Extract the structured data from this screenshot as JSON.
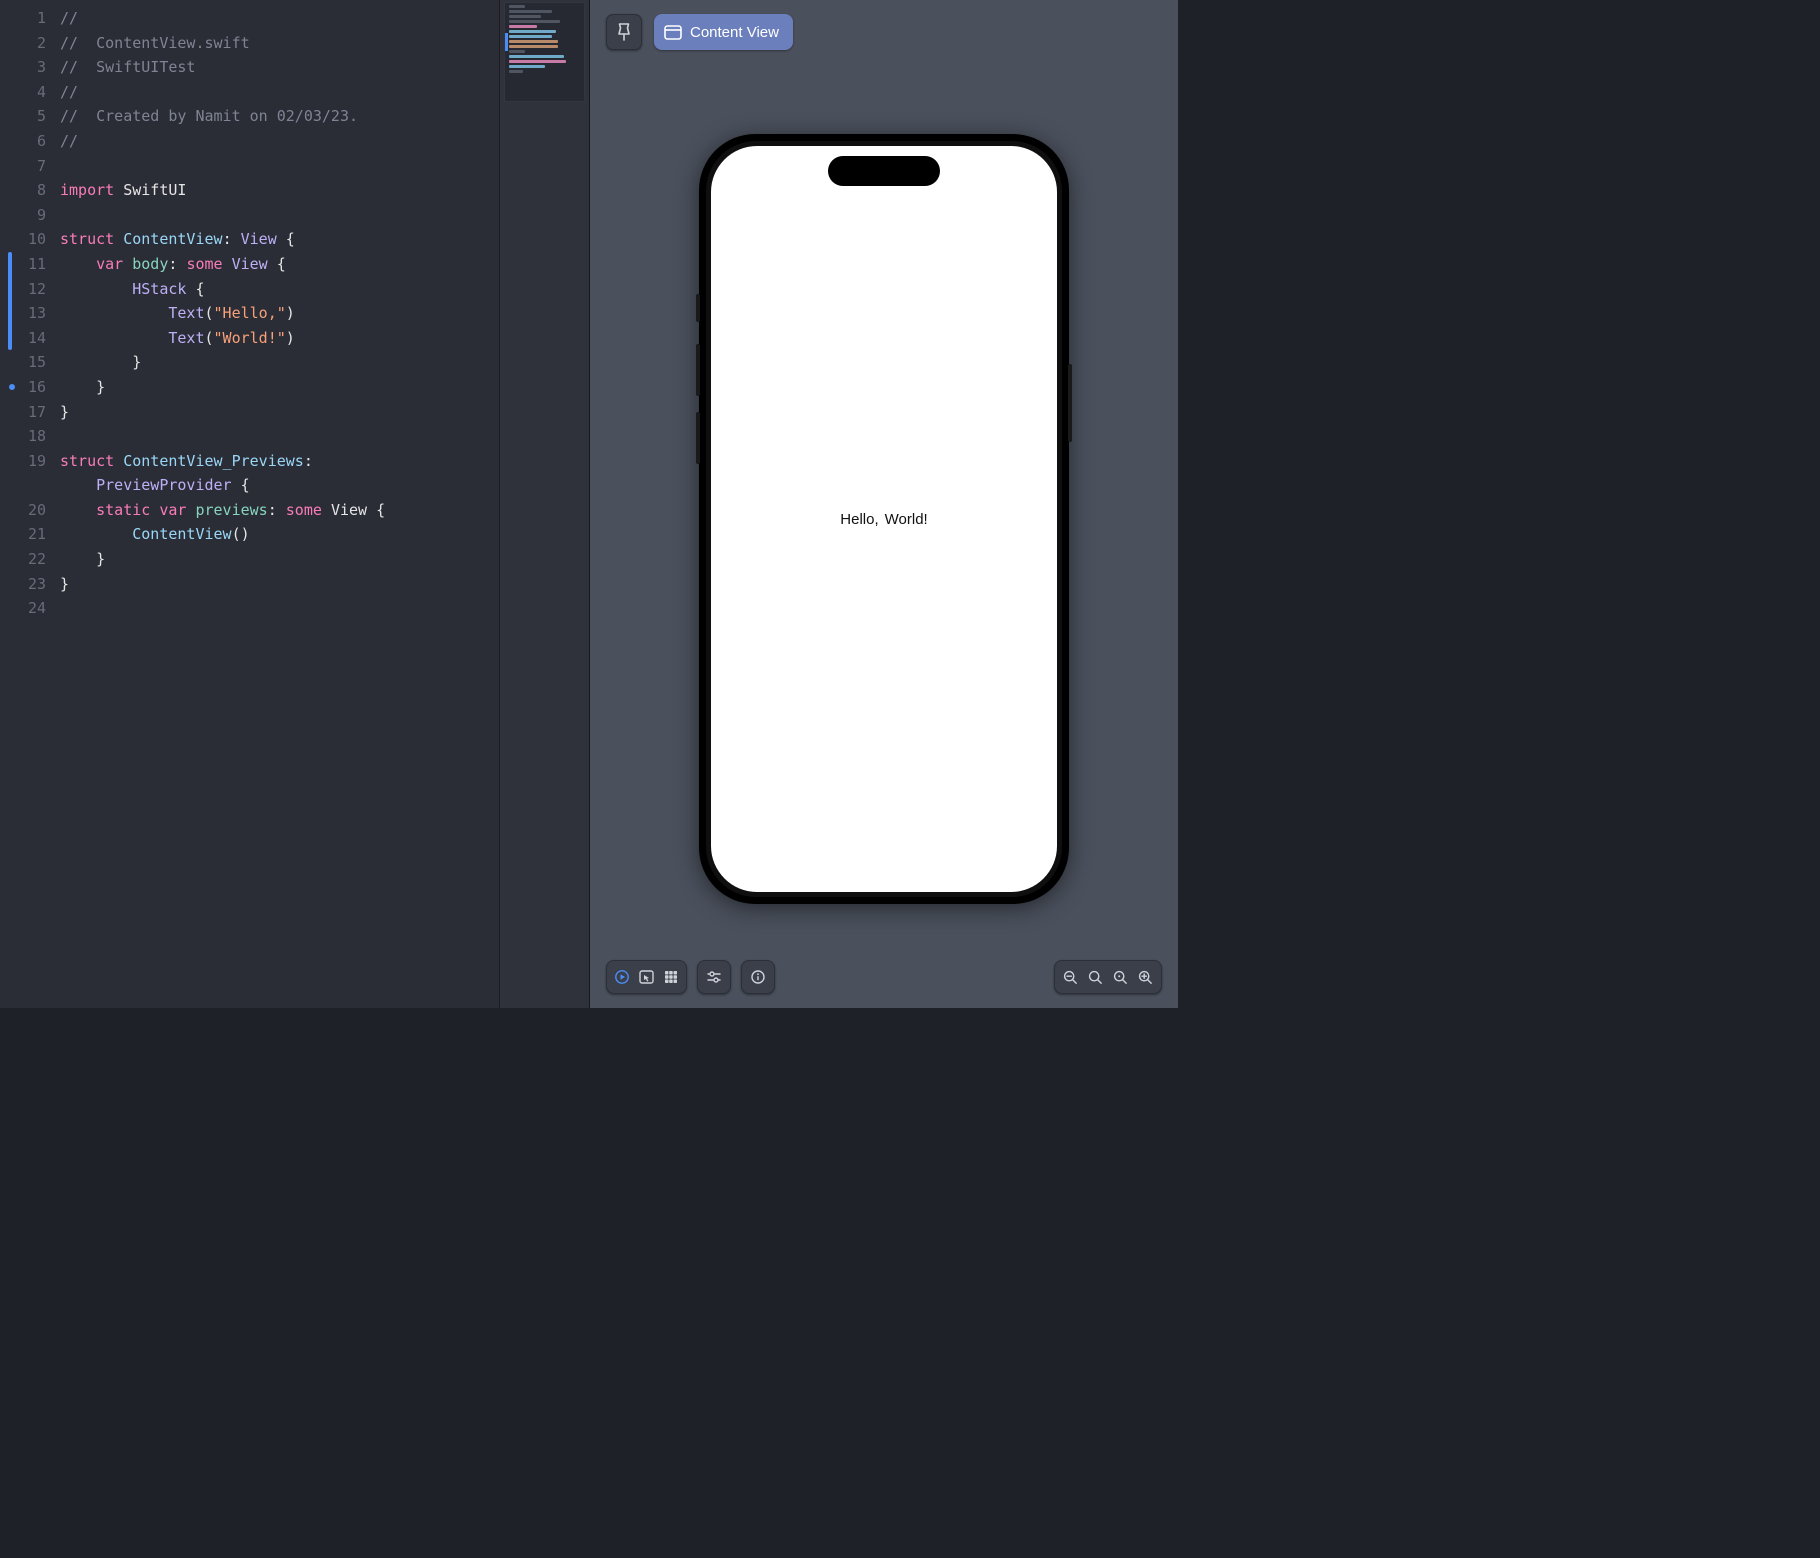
{
  "editor": {
    "lines": [
      {
        "num": 1,
        "tokens": [
          {
            "t": "//",
            "c": "c-comment"
          }
        ]
      },
      {
        "num": 2,
        "tokens": [
          {
            "t": "//  ContentView.swift",
            "c": "c-comment"
          }
        ]
      },
      {
        "num": 3,
        "tokens": [
          {
            "t": "//  SwiftUITest",
            "c": "c-comment"
          }
        ]
      },
      {
        "num": 4,
        "tokens": [
          {
            "t": "//",
            "c": "c-comment"
          }
        ]
      },
      {
        "num": 5,
        "tokens": [
          {
            "t": "//  Created by Namit on 02/03/23.",
            "c": "c-comment"
          }
        ]
      },
      {
        "num": 6,
        "tokens": [
          {
            "t": "//",
            "c": "c-comment"
          }
        ]
      },
      {
        "num": 7,
        "tokens": [
          {
            "t": "",
            "c": "c-plain"
          }
        ]
      },
      {
        "num": 8,
        "tokens": [
          {
            "t": "import",
            "c": "c-keyword"
          },
          {
            "t": " ",
            "c": "c-plain"
          },
          {
            "t": "SwiftUI",
            "c": "c-plain"
          }
        ]
      },
      {
        "num": 9,
        "tokens": [
          {
            "t": "",
            "c": "c-plain"
          }
        ]
      },
      {
        "num": 10,
        "tokens": [
          {
            "t": "struct",
            "c": "c-keyword"
          },
          {
            "t": " ",
            "c": "c-plain"
          },
          {
            "t": "ContentView",
            "c": "c-type"
          },
          {
            "t": ": ",
            "c": "c-plain"
          },
          {
            "t": "View",
            "c": "c-func"
          },
          {
            "t": " {",
            "c": "c-plain"
          }
        ]
      },
      {
        "num": 11,
        "tokens": [
          {
            "t": "    ",
            "c": "c-plain"
          },
          {
            "t": "var",
            "c": "c-keyword"
          },
          {
            "t": " ",
            "c": "c-plain"
          },
          {
            "t": "body",
            "c": "c-member"
          },
          {
            "t": ": ",
            "c": "c-plain"
          },
          {
            "t": "some",
            "c": "c-keyword"
          },
          {
            "t": " ",
            "c": "c-plain"
          },
          {
            "t": "View",
            "c": "c-func"
          },
          {
            "t": " {",
            "c": "c-plain"
          }
        ]
      },
      {
        "num": 12,
        "tokens": [
          {
            "t": "        ",
            "c": "c-plain"
          },
          {
            "t": "HStack",
            "c": "c-func"
          },
          {
            "t": " {",
            "c": "c-plain"
          }
        ]
      },
      {
        "num": 13,
        "tokens": [
          {
            "t": "            ",
            "c": "c-plain"
          },
          {
            "t": "Text",
            "c": "c-func"
          },
          {
            "t": "(",
            "c": "c-plain"
          },
          {
            "t": "\"Hello,\"",
            "c": "c-string"
          },
          {
            "t": ")",
            "c": "c-plain"
          }
        ]
      },
      {
        "num": 14,
        "tokens": [
          {
            "t": "            ",
            "c": "c-plain"
          },
          {
            "t": "Text",
            "c": "c-func"
          },
          {
            "t": "(",
            "c": "c-plain"
          },
          {
            "t": "\"World!\"",
            "c": "c-string"
          },
          {
            "t": ")",
            "c": "c-plain"
          }
        ]
      },
      {
        "num": 15,
        "tokens": [
          {
            "t": "        }",
            "c": "c-plain"
          }
        ]
      },
      {
        "num": 16,
        "tokens": [
          {
            "t": "    }",
            "c": "c-plain"
          }
        ]
      },
      {
        "num": 17,
        "tokens": [
          {
            "t": "}",
            "c": "c-plain"
          }
        ]
      },
      {
        "num": 18,
        "tokens": [
          {
            "t": "",
            "c": "c-plain"
          }
        ]
      },
      {
        "num": 19,
        "tokens": [
          {
            "t": "struct",
            "c": "c-keyword"
          },
          {
            "t": " ",
            "c": "c-plain"
          },
          {
            "t": "ContentView_Previews",
            "c": "c-type"
          },
          {
            "t": ":",
            "c": "c-plain"
          }
        ]
      },
      {
        "num": "",
        "tokens": [
          {
            "t": "    ",
            "c": "c-plain"
          },
          {
            "t": "PreviewProvider",
            "c": "c-func"
          },
          {
            "t": " {",
            "c": "c-plain"
          }
        ]
      },
      {
        "num": 20,
        "tokens": [
          {
            "t": "    ",
            "c": "c-plain"
          },
          {
            "t": "static",
            "c": "c-keyword"
          },
          {
            "t": " ",
            "c": "c-plain"
          },
          {
            "t": "var",
            "c": "c-keyword"
          },
          {
            "t": " ",
            "c": "c-plain"
          },
          {
            "t": "previews",
            "c": "c-member"
          },
          {
            "t": ": ",
            "c": "c-plain"
          },
          {
            "t": "some",
            "c": "c-keyword"
          },
          {
            "t": " ",
            "c": "c-plain"
          },
          {
            "t": "View",
            "c": "c-plain"
          },
          {
            "t": " {",
            "c": "c-plain"
          }
        ]
      },
      {
        "num": 21,
        "tokens": [
          {
            "t": "        ",
            "c": "c-plain"
          },
          {
            "t": "ContentView",
            "c": "c-type"
          },
          {
            "t": "()",
            "c": "c-plain"
          }
        ]
      },
      {
        "num": 22,
        "tokens": [
          {
            "t": "    }",
            "c": "c-plain"
          }
        ]
      },
      {
        "num": 23,
        "tokens": [
          {
            "t": "}",
            "c": "c-plain"
          }
        ]
      },
      {
        "num": 24,
        "tokens": [
          {
            "t": "",
            "c": "c-plain"
          }
        ]
      }
    ],
    "change_bar": {
      "from_line": 11,
      "to_line": 14
    },
    "dot_line": 16
  },
  "preview": {
    "chip_label": "Content View",
    "screen_text_1": "Hello,",
    "screen_text_2": "World!"
  },
  "toolbar": {
    "icons": {
      "pin": "pin-icon",
      "window": "window-icon",
      "play": "play-icon",
      "selectable": "selectable-icon",
      "grid": "grid-icon",
      "variants": "variants-icon",
      "info": "info-icon",
      "zoom_out": "zoom-out-icon",
      "zoom_fit": "zoom-fit-icon",
      "zoom_actual": "zoom-actual-icon",
      "zoom_in": "zoom-in-icon"
    }
  }
}
